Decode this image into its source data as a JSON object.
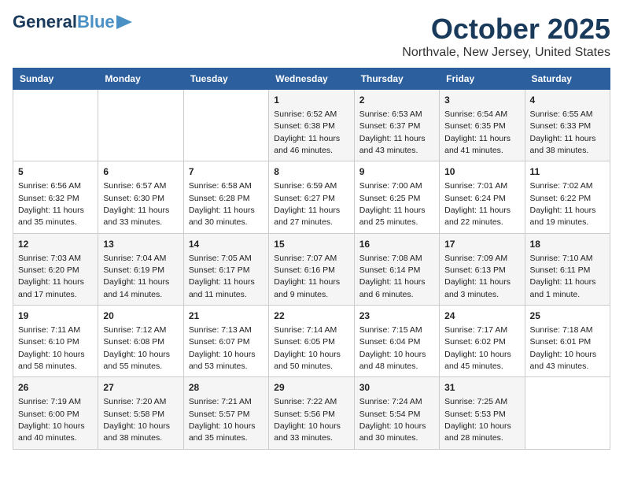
{
  "header": {
    "logo_line1": "General",
    "logo_line2": "Blue",
    "month": "October 2025",
    "location": "Northvale, New Jersey, United States"
  },
  "days_of_week": [
    "Sunday",
    "Monday",
    "Tuesday",
    "Wednesday",
    "Thursday",
    "Friday",
    "Saturday"
  ],
  "weeks": [
    [
      {
        "day": "",
        "info": ""
      },
      {
        "day": "",
        "info": ""
      },
      {
        "day": "",
        "info": ""
      },
      {
        "day": "1",
        "info": "Sunrise: 6:52 AM\nSunset: 6:38 PM\nDaylight: 11 hours\nand 46 minutes."
      },
      {
        "day": "2",
        "info": "Sunrise: 6:53 AM\nSunset: 6:37 PM\nDaylight: 11 hours\nand 43 minutes."
      },
      {
        "day": "3",
        "info": "Sunrise: 6:54 AM\nSunset: 6:35 PM\nDaylight: 11 hours\nand 41 minutes."
      },
      {
        "day": "4",
        "info": "Sunrise: 6:55 AM\nSunset: 6:33 PM\nDaylight: 11 hours\nand 38 minutes."
      }
    ],
    [
      {
        "day": "5",
        "info": "Sunrise: 6:56 AM\nSunset: 6:32 PM\nDaylight: 11 hours\nand 35 minutes."
      },
      {
        "day": "6",
        "info": "Sunrise: 6:57 AM\nSunset: 6:30 PM\nDaylight: 11 hours\nand 33 minutes."
      },
      {
        "day": "7",
        "info": "Sunrise: 6:58 AM\nSunset: 6:28 PM\nDaylight: 11 hours\nand 30 minutes."
      },
      {
        "day": "8",
        "info": "Sunrise: 6:59 AM\nSunset: 6:27 PM\nDaylight: 11 hours\nand 27 minutes."
      },
      {
        "day": "9",
        "info": "Sunrise: 7:00 AM\nSunset: 6:25 PM\nDaylight: 11 hours\nand 25 minutes."
      },
      {
        "day": "10",
        "info": "Sunrise: 7:01 AM\nSunset: 6:24 PM\nDaylight: 11 hours\nand 22 minutes."
      },
      {
        "day": "11",
        "info": "Sunrise: 7:02 AM\nSunset: 6:22 PM\nDaylight: 11 hours\nand 19 minutes."
      }
    ],
    [
      {
        "day": "12",
        "info": "Sunrise: 7:03 AM\nSunset: 6:20 PM\nDaylight: 11 hours\nand 17 minutes."
      },
      {
        "day": "13",
        "info": "Sunrise: 7:04 AM\nSunset: 6:19 PM\nDaylight: 11 hours\nand 14 minutes."
      },
      {
        "day": "14",
        "info": "Sunrise: 7:05 AM\nSunset: 6:17 PM\nDaylight: 11 hours\nand 11 minutes."
      },
      {
        "day": "15",
        "info": "Sunrise: 7:07 AM\nSunset: 6:16 PM\nDaylight: 11 hours\nand 9 minutes."
      },
      {
        "day": "16",
        "info": "Sunrise: 7:08 AM\nSunset: 6:14 PM\nDaylight: 11 hours\nand 6 minutes."
      },
      {
        "day": "17",
        "info": "Sunrise: 7:09 AM\nSunset: 6:13 PM\nDaylight: 11 hours\nand 3 minutes."
      },
      {
        "day": "18",
        "info": "Sunrise: 7:10 AM\nSunset: 6:11 PM\nDaylight: 11 hours\nand 1 minute."
      }
    ],
    [
      {
        "day": "19",
        "info": "Sunrise: 7:11 AM\nSunset: 6:10 PM\nDaylight: 10 hours\nand 58 minutes."
      },
      {
        "day": "20",
        "info": "Sunrise: 7:12 AM\nSunset: 6:08 PM\nDaylight: 10 hours\nand 55 minutes."
      },
      {
        "day": "21",
        "info": "Sunrise: 7:13 AM\nSunset: 6:07 PM\nDaylight: 10 hours\nand 53 minutes."
      },
      {
        "day": "22",
        "info": "Sunrise: 7:14 AM\nSunset: 6:05 PM\nDaylight: 10 hours\nand 50 minutes."
      },
      {
        "day": "23",
        "info": "Sunrise: 7:15 AM\nSunset: 6:04 PM\nDaylight: 10 hours\nand 48 minutes."
      },
      {
        "day": "24",
        "info": "Sunrise: 7:17 AM\nSunset: 6:02 PM\nDaylight: 10 hours\nand 45 minutes."
      },
      {
        "day": "25",
        "info": "Sunrise: 7:18 AM\nSunset: 6:01 PM\nDaylight: 10 hours\nand 43 minutes."
      }
    ],
    [
      {
        "day": "26",
        "info": "Sunrise: 7:19 AM\nSunset: 6:00 PM\nDaylight: 10 hours\nand 40 minutes."
      },
      {
        "day": "27",
        "info": "Sunrise: 7:20 AM\nSunset: 5:58 PM\nDaylight: 10 hours\nand 38 minutes."
      },
      {
        "day": "28",
        "info": "Sunrise: 7:21 AM\nSunset: 5:57 PM\nDaylight: 10 hours\nand 35 minutes."
      },
      {
        "day": "29",
        "info": "Sunrise: 7:22 AM\nSunset: 5:56 PM\nDaylight: 10 hours\nand 33 minutes."
      },
      {
        "day": "30",
        "info": "Sunrise: 7:24 AM\nSunset: 5:54 PM\nDaylight: 10 hours\nand 30 minutes."
      },
      {
        "day": "31",
        "info": "Sunrise: 7:25 AM\nSunset: 5:53 PM\nDaylight: 10 hours\nand 28 minutes."
      },
      {
        "day": "",
        "info": ""
      }
    ]
  ]
}
